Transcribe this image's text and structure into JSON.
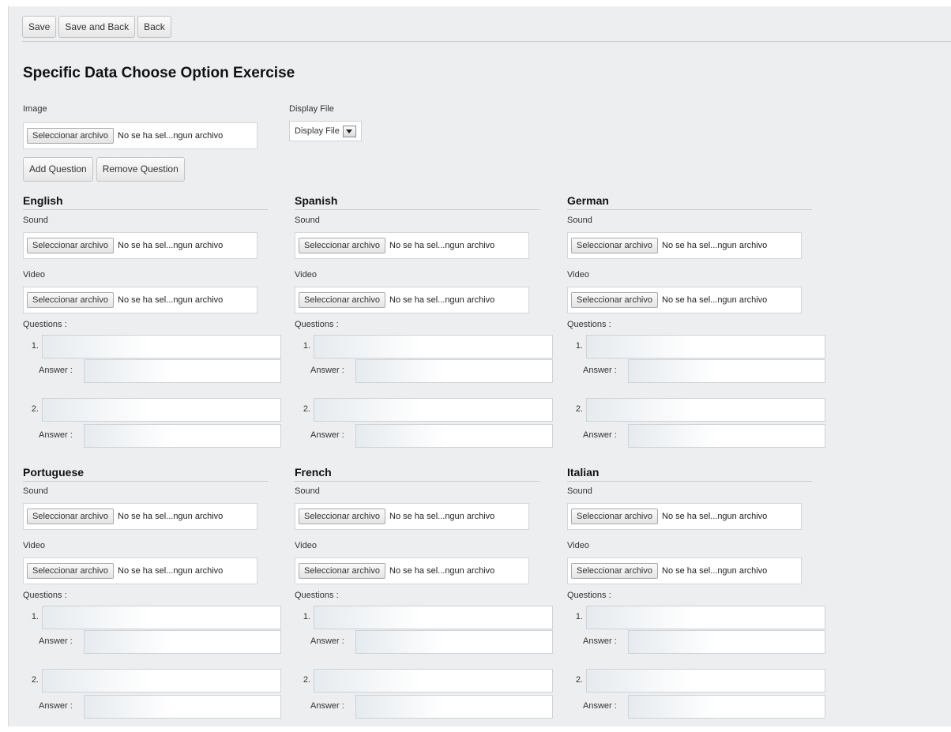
{
  "toolbar": {
    "save": "Save",
    "save_back": "Save and Back",
    "back": "Back"
  },
  "title": "Specific Data Choose Option Exercise",
  "image": {
    "label": "Image",
    "button": "Seleccionar archivo",
    "status": "No se ha sel...ngun archivo"
  },
  "display": {
    "label": "Display File",
    "value": "Display File"
  },
  "question_actions": {
    "add": "Add Question",
    "remove": "Remove Question"
  },
  "common": {
    "sound_label": "Sound",
    "video_label": "Video",
    "file_button": "Seleccionar archivo",
    "file_status": "No se ha sel...ngun archivo",
    "questions_label": "Questions :",
    "answer_label": "Answer :",
    "q1": "1.",
    "q2": "2."
  },
  "languages": [
    {
      "name": "English"
    },
    {
      "name": "Spanish"
    },
    {
      "name": "German"
    },
    {
      "name": "Portuguese"
    },
    {
      "name": "French"
    },
    {
      "name": "Italian"
    }
  ]
}
